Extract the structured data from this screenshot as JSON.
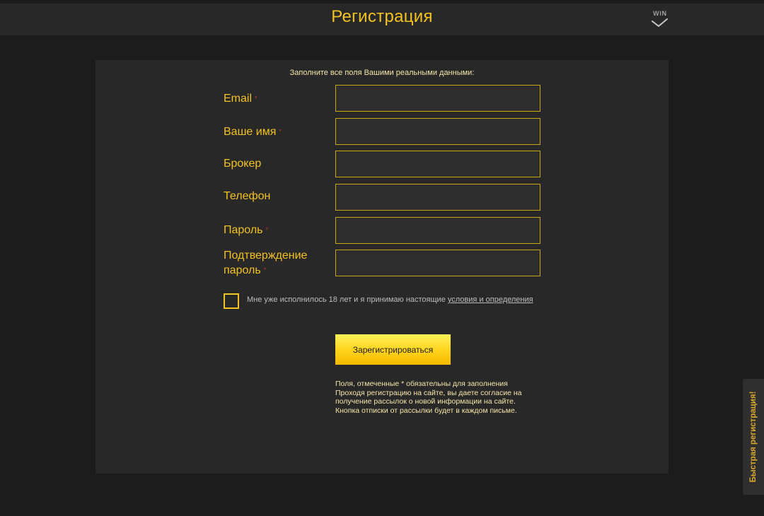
{
  "header": {
    "title": "Регистрация",
    "logo_text": "WIN"
  },
  "form": {
    "intro": "Заполните все поля Вашими реальными данными:",
    "required_mark": "*",
    "fields": [
      {
        "label": "Email",
        "required": true,
        "value": ""
      },
      {
        "label": "Ваше имя",
        "required": true,
        "value": ""
      },
      {
        "label": "Брокер",
        "required": false,
        "value": ""
      },
      {
        "label": "Телефон",
        "required": false,
        "value": ""
      },
      {
        "label": "Пароль",
        "required": true,
        "value": ""
      },
      {
        "label_line1": "Подтверждение",
        "label_line2": "пароль",
        "required": true,
        "value": ""
      }
    ],
    "agree_text": "Мне уже исполнилось 18 лет и я принимаю настоящие",
    "agree_link": "условия и определения",
    "agree_checked": false,
    "submit_label": "Зарегистрироваться",
    "note_lines": [
      "Поля, отмеченные * обязательны для заполнения",
      "Проходя регистрацию на сайте, вы даете согласие на",
      "получение рассылок о новой информации на сайте.",
      "Кнопка отписки от рассылки будет в каждом письме."
    ]
  },
  "side_tab": {
    "label": "Быстрая регистрация!"
  },
  "colors": {
    "accent": "#f3c221",
    "background": "#1c1c1c",
    "panel": "#282828",
    "required": "#c0392b",
    "button": "#ffd31a"
  }
}
